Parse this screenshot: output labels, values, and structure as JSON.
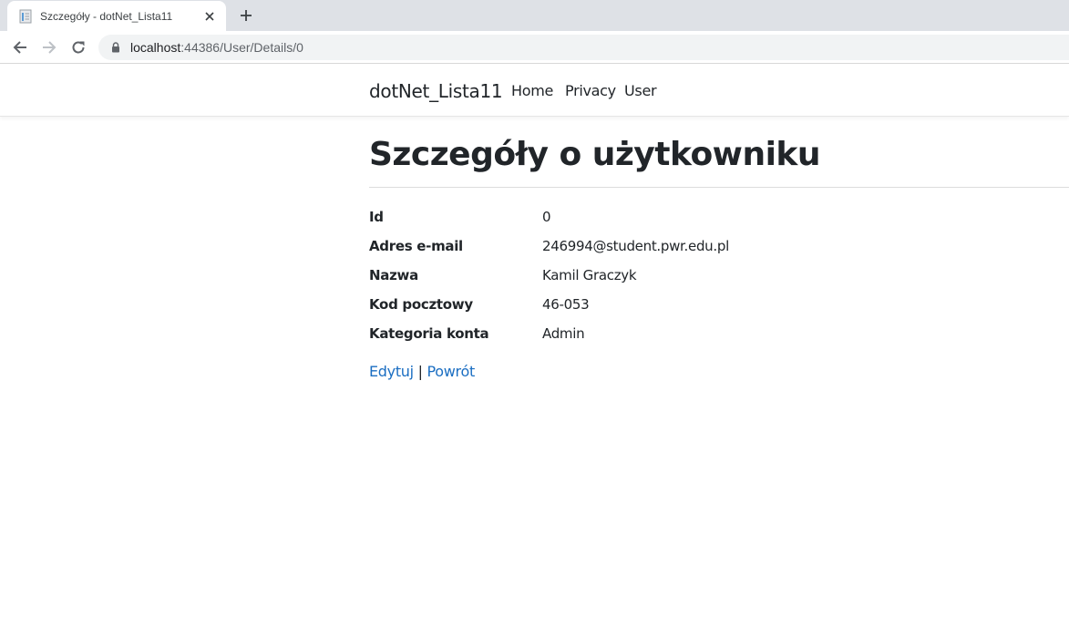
{
  "browser": {
    "tab": {
      "title": "Szczegóły - dotNet_Lista11",
      "favicon": "document-icon"
    },
    "address": {
      "host": "localhost",
      "path": ":44386/User/Details/0"
    },
    "colors": {
      "tabstrip": "#dee1e6",
      "omnibox": "#f1f3f4"
    }
  },
  "site": {
    "brand": "dotNet_Lista11",
    "nav": [
      "Home",
      "Privacy",
      "User"
    ]
  },
  "page": {
    "title": "Szczegóły o użytkowniku",
    "fields": [
      {
        "label": "Id",
        "value": "0"
      },
      {
        "label": "Adres e-mail",
        "value": "246994@student.pwr.edu.pl"
      },
      {
        "label": "Nazwa",
        "value": "Kamil Graczyk"
      },
      {
        "label": "Kod pocztowy",
        "value": "46-053"
      },
      {
        "label": "Kategoria konta",
        "value": "Admin"
      }
    ],
    "actions": {
      "edit": "Edytuj",
      "separator": "|",
      "back": "Powrót"
    },
    "link_color": "#1b6ec2"
  }
}
